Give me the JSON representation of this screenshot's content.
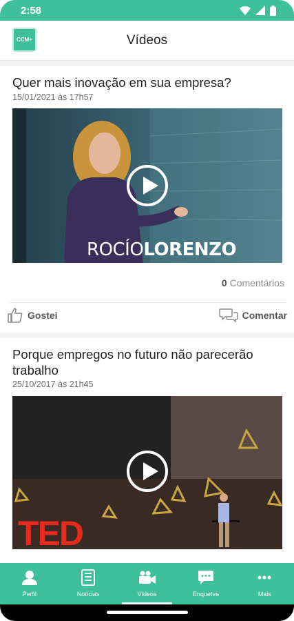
{
  "status_bar": {
    "time": "2:58"
  },
  "app_bar": {
    "logo_text": "CCM+",
    "title": "Vídeos"
  },
  "posts": [
    {
      "title": "Quer mais inovação em sua empresa?",
      "date": "15/01/2021 às 17h57",
      "video_caption_light": "ROCÍO",
      "video_caption_bold": "LORENZO",
      "comments_count": "0",
      "comments_label": "Comentários",
      "like_label": "Gostei",
      "comment_label": "Comentar"
    },
    {
      "title": "Porque empregos no futuro não parecerão trabalho",
      "date": "25/10/2017 às 21h45",
      "video_logo": "TED"
    }
  ],
  "bottom_nav": [
    {
      "label": "Perfil",
      "icon": "person-icon"
    },
    {
      "label": "Notícias",
      "icon": "newspaper-icon"
    },
    {
      "label": "Vídeos",
      "icon": "video-camera-icon",
      "active": true
    },
    {
      "label": "Enquetes",
      "icon": "chat-bubble-icon"
    },
    {
      "label": "Mais",
      "icon": "more-dots-icon"
    }
  ],
  "colors": {
    "primary": "#3fbf9a",
    "feed_background": "#f1f1f1"
  }
}
